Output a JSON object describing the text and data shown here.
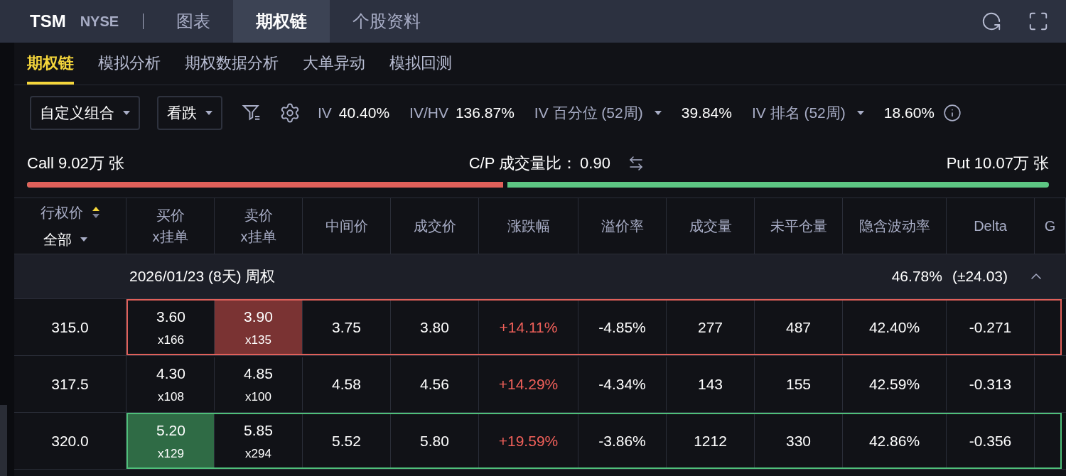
{
  "header": {
    "symbol": "TSM",
    "exchange": "NYSE",
    "tabs": [
      {
        "label": "图表",
        "selected": false
      },
      {
        "label": "期权链",
        "selected": true
      },
      {
        "label": "个股资料",
        "selected": false
      }
    ]
  },
  "subtabs": [
    {
      "label": "期权链",
      "selected": true
    },
    {
      "label": "模拟分析",
      "selected": false
    },
    {
      "label": "期权数据分析",
      "selected": false
    },
    {
      "label": "大单异动",
      "selected": false
    },
    {
      "label": "模拟回测",
      "selected": false
    }
  ],
  "toolbar": {
    "dropdowns": [
      "自定义组合",
      "看跌"
    ],
    "stats": [
      {
        "label": "IV",
        "value": "40.40%",
        "has_menu": false
      },
      {
        "label": "IV/HV",
        "value": "136.87%",
        "has_menu": false
      },
      {
        "label": "IV 百分位 (52周)",
        "value": "39.84%",
        "has_menu": true
      },
      {
        "label": "IV 排名 (52周)",
        "value": "18.60%",
        "has_menu": true
      }
    ]
  },
  "ratio": {
    "call": "Call 9.02万 张",
    "label": "C/P 成交量比：",
    "value": "0.90",
    "put": "Put 10.07万 张",
    "level": 0.47
  },
  "table": {
    "strike_header": "行权价",
    "strike_filter": "全部",
    "columns": [
      {
        "label": "买价",
        "sub": "x挂单"
      },
      {
        "label": "卖价",
        "sub": "x挂单"
      },
      {
        "label": "中间价"
      },
      {
        "label": "成交价"
      },
      {
        "label": "涨跌幅"
      },
      {
        "label": "溢价率"
      },
      {
        "label": "成交量"
      },
      {
        "label": "未平仓量"
      },
      {
        "label": "隐含波动率"
      },
      {
        "label": "Delta"
      },
      {
        "label": "G"
      }
    ],
    "group": {
      "title": "2026/01/23 (8天) 周权",
      "iv": "46.78%",
      "range": "(±24.03)",
      "expanded": true
    },
    "rows": [
      {
        "strike": "315.0",
        "bid": "3.60",
        "bid_size": "x166",
        "ask": "3.90",
        "ask_size": "x135",
        "mid": "3.75",
        "last": "3.80",
        "change": "+14.11%",
        "rising": true,
        "premium": "-4.85%",
        "volume": "277",
        "oi": "487",
        "iv": "42.40%",
        "delta": "-0.271",
        "ask_highlighted": true,
        "bid_highlighted": false
      },
      {
        "strike": "317.5",
        "bid": "4.30",
        "bid_size": "x108",
        "ask": "4.85",
        "ask_size": "x100",
        "mid": "4.58",
        "last": "4.56",
        "change": "+14.29%",
        "rising": true,
        "premium": "-4.34%",
        "volume": "143",
        "oi": "155",
        "iv": "42.59%",
        "delta": "-0.313",
        "ask_highlighted": false,
        "bid_highlighted": false
      },
      {
        "strike": "320.0",
        "bid": "5.20",
        "bid_size": "x129",
        "ask": "5.85",
        "ask_size": "x294",
        "mid": "5.52",
        "last": "5.80",
        "change": "+19.59%",
        "rising": true,
        "premium": "-3.86%",
        "volume": "1212",
        "oi": "330",
        "iv": "42.86%",
        "delta": "-0.356",
        "ask_highlighted": false,
        "bid_highlighted": true
      }
    ]
  }
}
